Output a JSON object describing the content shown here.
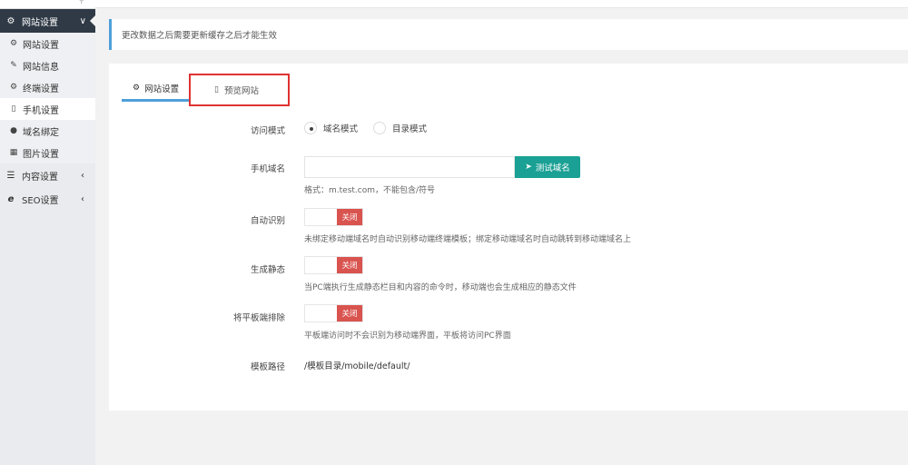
{
  "sidebar": {
    "search_icon": "search-icon",
    "groups": [
      {
        "label": "网站设置",
        "icon": "gear-icon",
        "arrow": "∨"
      },
      {
        "label": "内容设置",
        "icon": "list-icon",
        "arrow": "‹"
      },
      {
        "label": "SEO设置",
        "icon": "ie-icon",
        "arrow": "‹"
      }
    ],
    "items": [
      {
        "label": "网站设置",
        "icon": "gear-icon"
      },
      {
        "label": "网站信息",
        "icon": "edit-icon"
      },
      {
        "label": "终端设置",
        "icon": "gears-icon"
      },
      {
        "label": "手机设置",
        "icon": "mobile-icon"
      },
      {
        "label": "域名绑定",
        "icon": "globe-icon"
      },
      {
        "label": "图片设置",
        "icon": "image-icon"
      }
    ]
  },
  "notice": {
    "text": "更改数据之后需要更新缓存之后才能生效"
  },
  "tabs": [
    {
      "label": "网站设置",
      "icon": "gear-icon"
    },
    {
      "label": "预览网站",
      "icon": "mobile-icon"
    }
  ],
  "form": {
    "access_mode": {
      "label": "访问模式",
      "options": [
        "域名模式",
        "目录模式"
      ],
      "selected": "域名模式"
    },
    "mobile_domain": {
      "label": "手机域名",
      "value": "",
      "button": "测试域名",
      "help": "格式：m.test.com，不能包含/符号"
    },
    "auto_detect": {
      "label": "自动识别",
      "state": "关闭",
      "help": "未绑定移动端域名时自动识别移动端终端模板；绑定移动端域名时自动跳转到移动端域名上"
    },
    "generate_static": {
      "label": "生成静态",
      "state": "关闭",
      "help": "当PC端执行生成静态栏目和内容的命令时，移动端也会生成相应的静态文件"
    },
    "exclude_tablet": {
      "label": "将平板端排除",
      "state": "关闭",
      "help": "平板端访问时不会识别为移动端界面，平板将访问PC界面"
    },
    "template_path": {
      "label": "模板路径",
      "value": "/模板目录/mobile/default/"
    }
  },
  "colors": {
    "sidebar_active": "#303a46",
    "accent_blue": "#4e9fd8",
    "button_teal": "#1aa094",
    "switch_off_red": "#d9534f",
    "highlight_red": "#e03232"
  }
}
